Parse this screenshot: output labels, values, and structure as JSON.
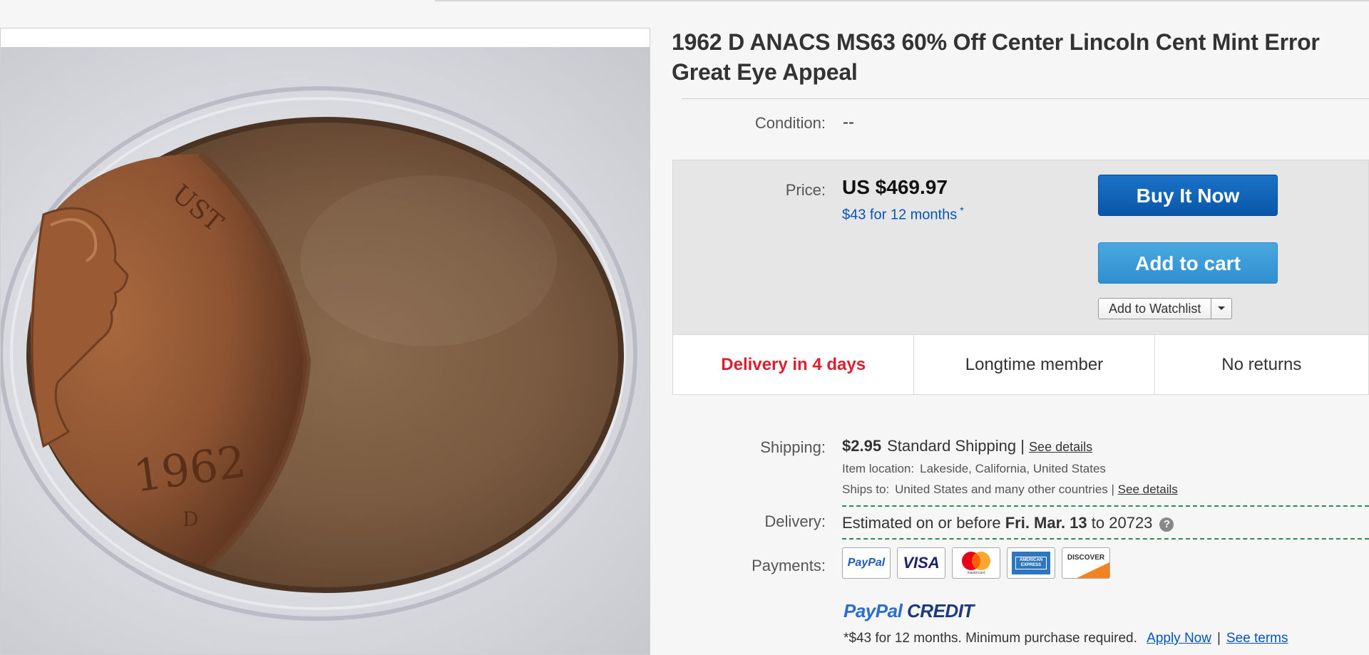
{
  "listing": {
    "title": "1962 D ANACS MS63 60% Off Center Lincoln Cent Mint Error Great Eye Appeal",
    "coin_year": "1962",
    "coin_mint": "D",
    "coin_motto": "UST"
  },
  "condition": {
    "label": "Condition:",
    "value": "--"
  },
  "price": {
    "label": "Price:",
    "value": "US $469.97",
    "monthly": "$43 for 12 months",
    "monthly_mark": "*"
  },
  "actions": {
    "buy_now": "Buy It Now",
    "add_to_cart": "Add to cart",
    "watchlist": "Add to Watchlist"
  },
  "highlights": [
    "Delivery in 4 days",
    "Longtime member",
    "No returns"
  ],
  "shipping": {
    "label": "Shipping:",
    "cost": "$2.95",
    "method": "Standard Shipping |",
    "details_link": "See details",
    "location_label": "Item location:",
    "location": "Lakeside, California, United States",
    "ships_to_label": "Ships to:",
    "ships_to": "United States and many other countries |",
    "ships_to_link": "See details"
  },
  "delivery": {
    "label": "Delivery:",
    "prefix": "Estimated on or before",
    "date": "Fri. Mar. 13",
    "to_text": "to 20723",
    "help": "?"
  },
  "payments": {
    "label": "Payments:",
    "methods": [
      "PayPal",
      "VISA",
      "mastercard",
      "AMERICAN EXPRESS",
      "DISCOVER"
    ]
  },
  "paypal_credit": {
    "brand_a": "PayPal",
    "brand_b": "CREDIT",
    "note": "*$43 for 12 months. Minimum purchase required.",
    "apply_link": "Apply Now",
    "separator": "|",
    "terms_link": "See terms"
  },
  "colors": {
    "buy_button": "#0a56a8",
    "cart_button": "#2f90d0",
    "delivery_highlight": "#dd1e31",
    "link_blue": "#0654ba",
    "dashed_rule": "#2e8b57"
  },
  "icons": [
    "dropdown-caret-icon",
    "help-icon",
    "paypal-logo",
    "visa-logo",
    "mastercard-logo",
    "amex-logo",
    "discover-logo"
  ]
}
